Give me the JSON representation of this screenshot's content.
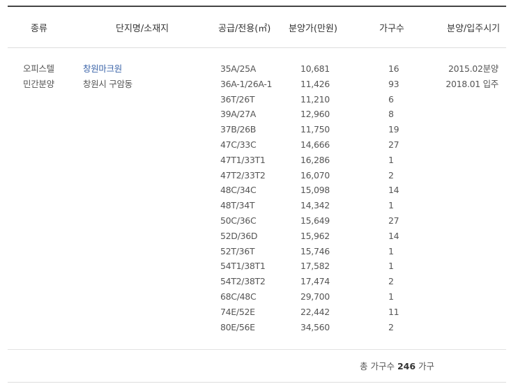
{
  "headers": {
    "type": "종류",
    "complex": "단지명/소재지",
    "area": "공급/전용(㎡)",
    "price": "분양가(만원)",
    "households": "가구수",
    "schedule": "분양/입주시기"
  },
  "listing": {
    "type_line1": "오피스텔",
    "type_line2": "민간분양",
    "name": "창원마크원",
    "location": "창원시 구암동",
    "sale_date": "2015.02분양",
    "move_in_date": "2018.01 입주"
  },
  "units": [
    {
      "area": "35A/25A",
      "price": "10,681",
      "count": "16"
    },
    {
      "area": "36A-1/26A-1",
      "price": "11,426",
      "count": "93"
    },
    {
      "area": "36T/26T",
      "price": "11,210",
      "count": "6"
    },
    {
      "area": "39A/27A",
      "price": "12,960",
      "count": "8"
    },
    {
      "area": "37B/26B",
      "price": "11,750",
      "count": "19"
    },
    {
      "area": "47C/33C",
      "price": "14,666",
      "count": "27"
    },
    {
      "area": "47T1/33T1",
      "price": "16,286",
      "count": "1"
    },
    {
      "area": "47T2/33T2",
      "price": "16,070",
      "count": "2"
    },
    {
      "area": "48C/34C",
      "price": "15,098",
      "count": "14"
    },
    {
      "area": "48T/34T",
      "price": "14,342",
      "count": "1"
    },
    {
      "area": "50C/36C",
      "price": "15,649",
      "count": "27"
    },
    {
      "area": "52D/36D",
      "price": "15,962",
      "count": "14"
    },
    {
      "area": "52T/36T",
      "price": "15,746",
      "count": "1"
    },
    {
      "area": "54T1/38T1",
      "price": "17,582",
      "count": "1"
    },
    {
      "area": "54T2/38T2",
      "price": "17,474",
      "count": "2"
    },
    {
      "area": "68C/48C",
      "price": "29,700",
      "count": "1"
    },
    {
      "area": "74E/52E",
      "price": "22,442",
      "count": "11"
    },
    {
      "area": "80E/56E",
      "price": "34,560",
      "count": "2"
    }
  ],
  "total": {
    "prefix": "총 가구수 ",
    "value": "246",
    "suffix": " 가구"
  },
  "colors": {
    "link": "#3a63a8",
    "top_rule": "#444444",
    "text": "#555555"
  }
}
